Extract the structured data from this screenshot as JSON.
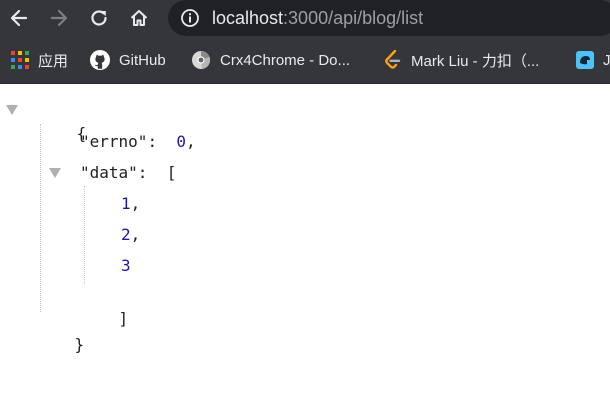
{
  "browser": {
    "url_host": "localhost",
    "url_path": ":3000/api/blog/list",
    "nav": {
      "back_icon": "arrow-left-icon",
      "forward_icon": "arrow-right-icon",
      "reload_icon": "reload-icon",
      "home_icon": "home-icon",
      "info_icon": "info-icon"
    },
    "bookmarks": [
      {
        "label": "应用",
        "icon": "apps-grid-icon"
      },
      {
        "label": "GitHub",
        "icon": "github-icon"
      },
      {
        "label": "Crx4Chrome - Do...",
        "icon": "crx4chrome-icon"
      },
      {
        "label": "Mark Liu - 力扣（...",
        "icon": "leetcode-icon"
      },
      {
        "label": "J",
        "icon": "bookmark-icon"
      }
    ]
  },
  "json_view": {
    "open_brace": "{",
    "close_brace": "}",
    "errno_key": "\"errno\"",
    "errno_value": "0",
    "data_key": "\"data\"",
    "open_bracket": "[",
    "close_bracket": "]",
    "data_values": [
      "1",
      "2",
      "3"
    ],
    "colon": ":",
    "comma": ","
  },
  "colors": {
    "chrome_bg": "#35363a",
    "omnibox_bg": "#202124",
    "number": "#1a1aa6",
    "toggle": "#b0b0b0"
  }
}
